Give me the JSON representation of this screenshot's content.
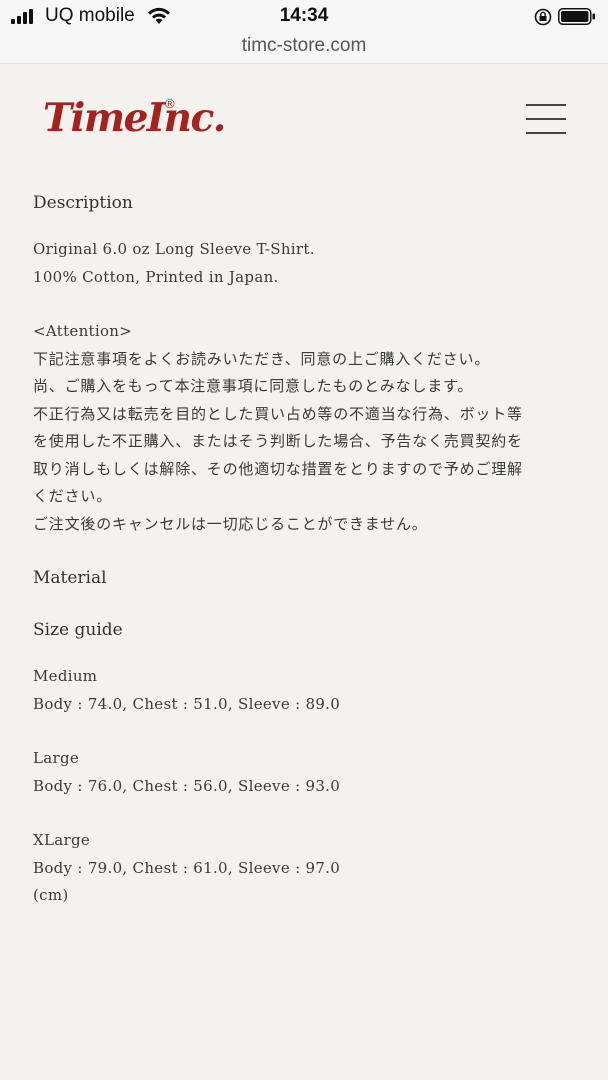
{
  "status_bar": {
    "carrier": "UQ mobile",
    "time": "14:34"
  },
  "browser": {
    "url": "timc-store.com"
  },
  "header": {
    "logo_text": "TimeInc.",
    "logo_registered": "®",
    "menu_icon": "hamburger-menu-icon"
  },
  "product": {
    "description_heading": "Description",
    "description_lines": [
      "Original 6.0 oz Long Sleeve T-Shirt.",
      "100% Cotton, Printed in Japan."
    ],
    "attention_label": "<Attention>",
    "attention_lines": [
      "下記注意事項をよくお読みいただき、同意の上ご購入ください。",
      "尚、ご購入をもって本注意事項に同意したものとみなします。",
      "不正行為又は転売を目的とした買い占め等の不適当な行為、ボット等",
      "を使用した不正購入、またはそう判断した場合、予告なく売買契約を",
      "取り消しもしくは解除、その他適切な措置をとりますので予めご理解",
      "ください。",
      "ご注文後のキャンセルは一切応じることができません。"
    ],
    "material_heading": "Material",
    "size_guide_heading": "Size guide",
    "sizes": [
      {
        "name": "Medium",
        "measurements": "Body : 74.0, Chest : 51.0, Sleeve : 89.0"
      },
      {
        "name": "Large",
        "measurements": "Body : 76.0, Chest : 56.0, Sleeve : 93.0"
      },
      {
        "name": "XLarge",
        "measurements": "Body : 79.0, Chest : 61.0, Sleeve : 97.0"
      }
    ],
    "unit_note": "(cm)"
  },
  "colors": {
    "brand_red": "#a3231e",
    "page_background": "#f4f2ef",
    "text": "#3a3a3a"
  }
}
